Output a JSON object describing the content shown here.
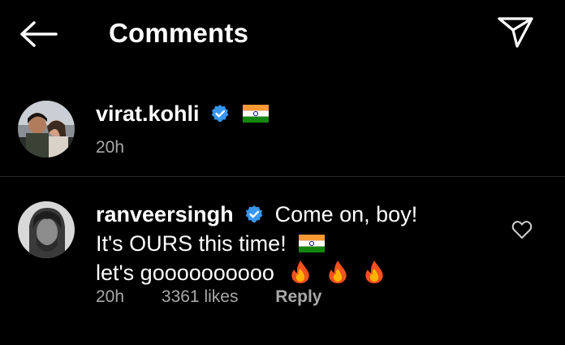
{
  "header": {
    "title": "Comments",
    "back_icon": "arrow-left-icon",
    "send_icon": "paper-plane-icon"
  },
  "caption": {
    "username": "virat.kohli",
    "verified": true,
    "emoji": "india-flag",
    "time": "20h"
  },
  "comment": {
    "username": "ranveersingh",
    "verified": true,
    "line1": "Come on, boy!",
    "line2": "It's OURS this time!",
    "line2_emoji": "india-flag",
    "line3": "let's goooooooooo",
    "line3_emojis": [
      "fire",
      "fire",
      "fire"
    ],
    "time": "20h",
    "likes": "3361 likes",
    "reply_label": "Reply",
    "like_icon": "heart-outline-icon"
  },
  "colors": {
    "background": "#000000",
    "text": "#ffffff",
    "muted": "#a8a8a8",
    "verified": "#3897f0",
    "divider": "#262626"
  }
}
